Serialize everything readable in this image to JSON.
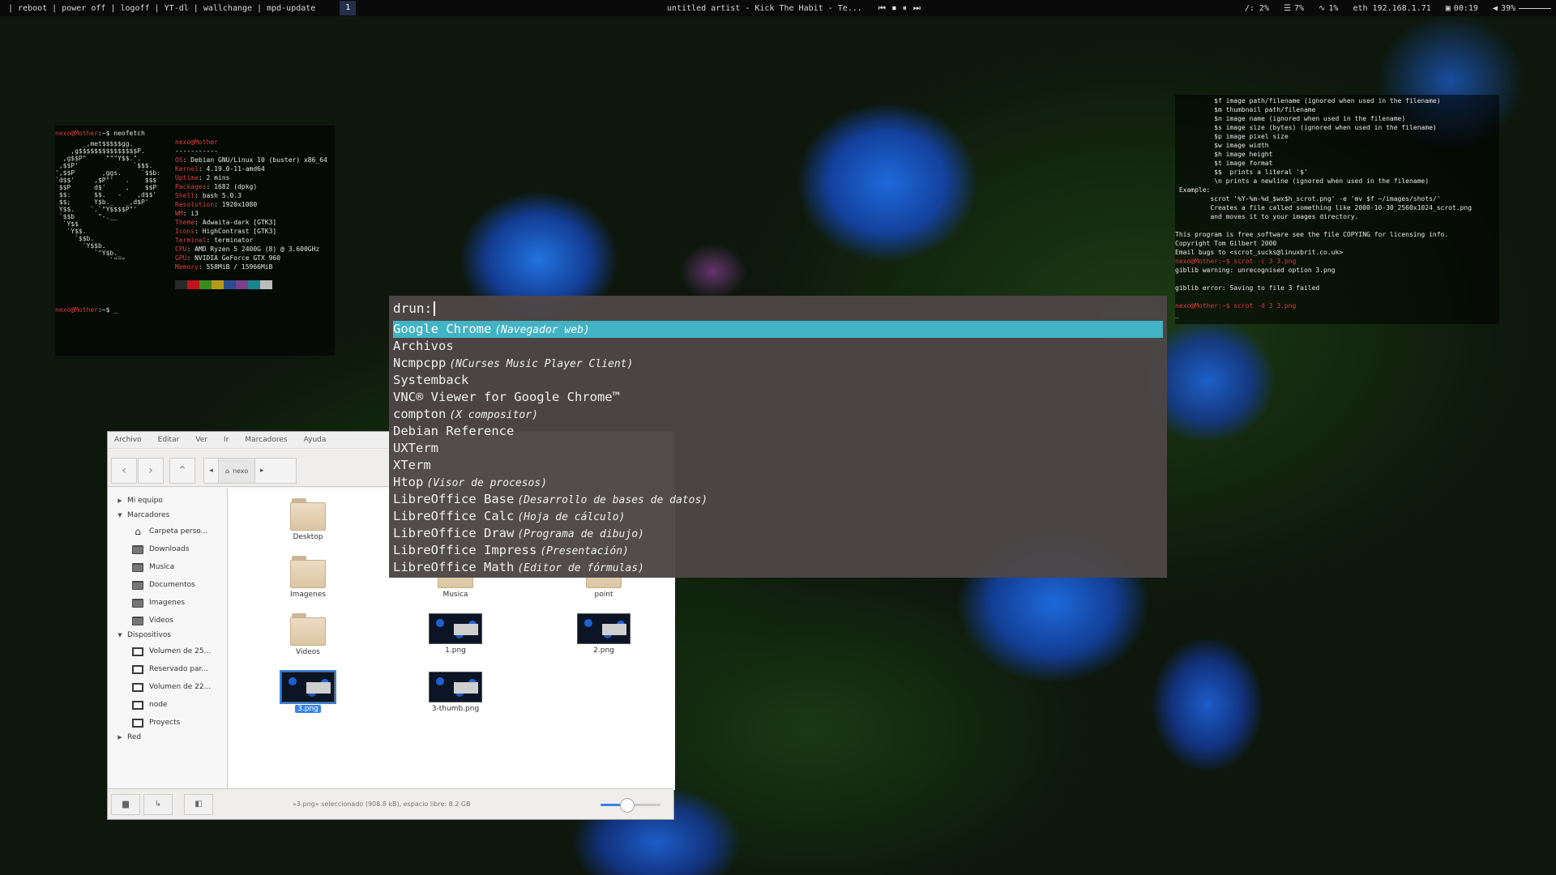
{
  "topbar": {
    "commands": "| reboot | power off | logoff | YT-dl | wallchange | mpd-update",
    "workspace": "1",
    "now_playing": "untitled artist - Kick The Habit - Te...",
    "player": {
      "prev": "⏮",
      "stop": "⏹",
      "pause": "⏸",
      "next": "⏭"
    },
    "disk": "/: 2%",
    "mem": "7%",
    "cpu": "1%",
    "eth": "eth 192.168.1.71",
    "clock": "00:19",
    "volume": "39%"
  },
  "term_left": {
    "prompt1_user": "nexo@Mother",
    "prompt1_rest": ":~$ neofetch",
    "ascii": "       _,met$$$$$gg.\n    ,g$$$$$$$$$$$$$$$P.\n  ,g$$P\"     \"\"\"Y$$.\".\n ,$$P'              `$$$.\n',$$P       ,ggs.     `$$b:\n`d$$'     ,$P\"'   .    $$$\n $$P      d$'     ,    $$P\n $$:      $$.   -    ,d$$'\n $$;      Y$b._   _,d$P'\n Y$$.    `.`\"Y$$$$P\"'\n `$$b      \"-.__\n  `Y$$\n   `Y$$.\n     `$$b.\n       `Y$$b.\n          `\"Y$b._\n              `\"\"\"",
    "user": "nexo@Mother",
    "sep": "-----------",
    "info": [
      {
        "k": "OS",
        "v": "Debian GNU/Linux 10 (buster) x86_64"
      },
      {
        "k": "Kernel",
        "v": "4.19.0-11-amd64"
      },
      {
        "k": "Uptime",
        "v": "2 mins"
      },
      {
        "k": "Packages",
        "v": "1682 (dpkg)"
      },
      {
        "k": "Shell",
        "v": "bash 5.0.3"
      },
      {
        "k": "Resolution",
        "v": "1920x1080"
      },
      {
        "k": "WM",
        "v": "i3"
      },
      {
        "k": "Theme",
        "v": "Adwaita-dark [GTK3]"
      },
      {
        "k": "Icons",
        "v": "HighContrast [GTK3]"
      },
      {
        "k": "Terminal",
        "v": "terminator"
      },
      {
        "k": "CPU",
        "v": "AMD Ryzen 5 2400G (8) @ 3.600GHz"
      },
      {
        "k": "GPU",
        "v": "NVIDIA GeForce GTX 960"
      },
      {
        "k": "Memory",
        "v": "558MiB / 15966MiB"
      }
    ],
    "palette": [
      "#2a2a2a",
      "#c0141c",
      "#3a8c1e",
      "#b59a1a",
      "#2a4d8f",
      "#7b3f8c",
      "#17868f",
      "#bdbdbd"
    ],
    "prompt2_user": "nexo@Mother",
    "prompt2_rest": ":~$ _"
  },
  "term_right": {
    "lines": [
      {
        "t": "          $f image path/filename (ignored when used in the filename)"
      },
      {
        "t": "          $m thumbnail path/filename"
      },
      {
        "t": "          $n image name (ignored when used in the filename)"
      },
      {
        "t": "          $s image size (bytes) (ignored when used in the filename)"
      },
      {
        "t": "          $p image pixel size"
      },
      {
        "t": "          $w image width"
      },
      {
        "t": "          $h image height"
      },
      {
        "t": "          $t image format"
      },
      {
        "t": "          $$  prints a literal '$'"
      },
      {
        "t": "          \\n prints a newline (ignored when used in the filename)"
      },
      {
        "t": " Example:"
      },
      {
        "t": "         scrot '%Y-%m-%d_$wx$h_scrot.png' -e 'mv $f ~/images/shots/'"
      },
      {
        "t": "         Creates a file called something like 2000-10-30_2560x1024_scrot.png"
      },
      {
        "t": "         and moves it to your images directory."
      },
      {
        "t": ""
      },
      {
        "t": "This program is free software see the file COPYING for licensing info."
      },
      {
        "t": "Copyright Tom Gilbert 2000"
      },
      {
        "t": "Email bugs to <scrot_sucks@linuxbrit.co.uk>"
      },
      {
        "t": "nexo@Mother:~$ scrot -c 3 3.png",
        "prompt": true
      },
      {
        "t": "giblib warning: unrecognised option 3.png"
      },
      {
        "t": ""
      },
      {
        "t": "giblib error: Saving to file 3 failed"
      },
      {
        "t": ""
      },
      {
        "t": "nexo@Mother:~$ scrot -d 3 3.png",
        "prompt": true
      },
      {
        "t": "_"
      }
    ]
  },
  "file_manager": {
    "menu": [
      "Archivo",
      "Editar",
      "Ver",
      "Ir",
      "Marcadores",
      "Ayuda"
    ],
    "path_crumb": "nexo",
    "sidebar": {
      "mi_equipo": "Mi equipo",
      "marcadores": "Marcadores",
      "bookmarks": [
        "Carpeta perso...",
        "Downloads",
        "Musica",
        "Documentos",
        "Imagenes",
        "Videos"
      ],
      "dispositivos": "Dispositivos",
      "devices": [
        "Volumen de 25...",
        "Reservado par...",
        "Volumen de 22...",
        "node",
        "Proyects"
      ],
      "red": "Red"
    },
    "items": [
      {
        "name": "Desktop",
        "kind": "folder"
      },
      {
        "name": "Imagenes",
        "kind": "folder"
      },
      {
        "name": "Musica",
        "kind": "folder"
      },
      {
        "name": "point",
        "kind": "folder"
      },
      {
        "name": "Videos",
        "kind": "folder"
      },
      {
        "name": "1.png",
        "kind": "image"
      },
      {
        "name": "2.png",
        "kind": "image"
      },
      {
        "name": "3.png",
        "kind": "image",
        "selected": true
      },
      {
        "name": "3-thumb.png",
        "kind": "image"
      }
    ],
    "status": "«3.png» seleccionado (908.8 kB), espacio libre: 8.2 GB",
    "zoom_fraction": 0.45
  },
  "rofi": {
    "prompt": "drun:",
    "input_value": "",
    "items": [
      {
        "name": "Google Chrome",
        "desc": "(Navegador web)",
        "selected": true
      },
      {
        "name": "Archivos",
        "desc": ""
      },
      {
        "name": "Ncmpcpp",
        "desc": "(NCurses Music Player Client)"
      },
      {
        "name": "Systemback",
        "desc": ""
      },
      {
        "name": "VNC® Viewer for Google Chrome™",
        "desc": ""
      },
      {
        "name": "compton",
        "desc": "(X compositor)"
      },
      {
        "name": "Debian Reference",
        "desc": ""
      },
      {
        "name": "UXTerm",
        "desc": ""
      },
      {
        "name": "XTerm",
        "desc": ""
      },
      {
        "name": "Htop",
        "desc": "(Visor de procesos)"
      },
      {
        "name": "LibreOffice Base",
        "desc": "(Desarrollo de bases de datos)"
      },
      {
        "name": "LibreOffice Calc",
        "desc": "(Hoja de cálculo)"
      },
      {
        "name": "LibreOffice Draw",
        "desc": "(Programa de dibujo)"
      },
      {
        "name": "LibreOffice Impress",
        "desc": "(Presentación)"
      },
      {
        "name": "LibreOffice Math",
        "desc": "(Editor de fórmulas)"
      }
    ],
    "selected_color": "#42b3c4"
  }
}
